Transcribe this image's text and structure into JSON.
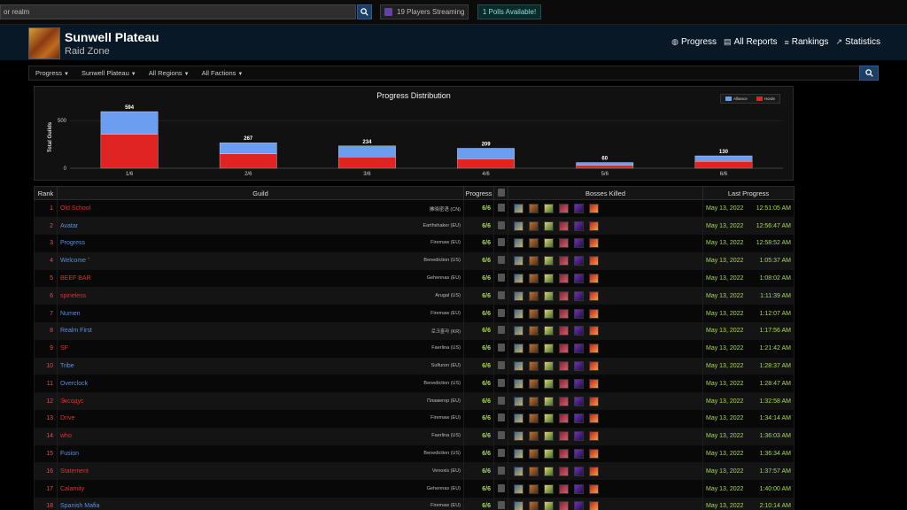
{
  "topbar": {
    "search_text": "or realm",
    "streaming_label": "19 Players Streaming",
    "polls_label": "1 Polls Available!"
  },
  "header": {
    "title": "Sunwell Plateau",
    "subtitle": "Raid Zone",
    "nav": [
      {
        "label": "Progress",
        "icon": "globe-icon"
      },
      {
        "label": "All Reports",
        "icon": "list-icon"
      },
      {
        "label": "Rankings",
        "icon": "bars-icon"
      },
      {
        "label": "Statistics",
        "icon": "trend-icon"
      }
    ]
  },
  "filters": [
    {
      "label": "Progress"
    },
    {
      "label": "Sunwell Plateau"
    },
    {
      "label": "All Regions"
    },
    {
      "label": "All Factions"
    }
  ],
  "colors": {
    "alliance": "#6b9ef0",
    "horde": "#e02424",
    "progress_green": "#a8d858"
  },
  "chart_data": {
    "type": "bar",
    "title": "Progress Distribution",
    "ylabel": "Total Guilds",
    "categories": [
      "1/6",
      "2/6",
      "3/6",
      "4/6",
      "5/6",
      "6/6"
    ],
    "totals": [
      594,
      267,
      234,
      209,
      60,
      130
    ],
    "series": [
      {
        "name": "Horde",
        "values": [
          355,
          150,
          118,
          98,
          32,
          72
        ]
      },
      {
        "name": "Alliance",
        "values": [
          239,
          117,
          116,
          111,
          28,
          58
        ]
      }
    ],
    "yticks": [
      0,
      500
    ],
    "ylim": [
      0,
      650
    ],
    "stacked": true,
    "legend": "top-right"
  },
  "table": {
    "headers": {
      "rank": "Rank",
      "guild": "Guild",
      "progress": "Progress",
      "bosses": "Bosses Killed",
      "last": "Last Progress"
    },
    "boss_icons": [
      "kalecgos-icon",
      "brutallus-icon",
      "felmyst-icon",
      "eredar-twins-icon",
      "muru-icon",
      "kiljaeden-icon"
    ],
    "rows": [
      {
        "rank": "1",
        "guild": "Old School",
        "faction": "horde",
        "realm": "拂晓密语 (CN)",
        "progress": "6/6",
        "date": "May 13, 2022",
        "time": "12:51:05 AM"
      },
      {
        "rank": "2",
        "guild": "Avatar",
        "faction": "alliance",
        "realm": "Earthshaker (EU)",
        "progress": "6/6",
        "date": "May 13, 2022",
        "time": "12:56:47 AM"
      },
      {
        "rank": "3",
        "guild": "Progress",
        "faction": "alliance",
        "realm": "Firemaw (EU)",
        "progress": "6/6",
        "date": "May 13, 2022",
        "time": "12:58:52 AM"
      },
      {
        "rank": "4",
        "guild": "Welcome",
        "faction": "alliance",
        "star": true,
        "realm": "Benediction (US)",
        "progress": "6/6",
        "date": "May 13, 2022",
        "time": "1:05:37 AM"
      },
      {
        "rank": "5",
        "guild": "BEEF BAR",
        "faction": "horde",
        "realm": "Gehennas (EU)",
        "progress": "6/6",
        "date": "May 13, 2022",
        "time": "1:08:02 AM"
      },
      {
        "rank": "6",
        "guild": "spineless",
        "faction": "horde",
        "realm": "Arugal (US)",
        "progress": "6/6",
        "date": "May 13, 2022",
        "time": "1:11:39 AM"
      },
      {
        "rank": "7",
        "guild": "Numen",
        "faction": "alliance",
        "realm": "Firemaw (EU)",
        "progress": "6/6",
        "date": "May 13, 2022",
        "time": "1:12:07 AM"
      },
      {
        "rank": "8",
        "guild": "Realm First",
        "faction": "alliance",
        "realm": "로크홀라 (KR)",
        "progress": "6/6",
        "date": "May 13, 2022",
        "time": "1:17:56 AM"
      },
      {
        "rank": "9",
        "guild": "SF",
        "faction": "horde",
        "realm": "Faerlina (US)",
        "progress": "6/6",
        "date": "May 13, 2022",
        "time": "1:21:42 AM"
      },
      {
        "rank": "10",
        "guild": "Tribe",
        "faction": "alliance",
        "realm": "Sulfuron (EU)",
        "progress": "6/6",
        "date": "May 13, 2022",
        "time": "1:28:37 AM"
      },
      {
        "rank": "11",
        "guild": "Overclock",
        "faction": "alliance",
        "realm": "Benediction (US)",
        "progress": "6/6",
        "date": "May 13, 2022",
        "time": "1:28:47 AM"
      },
      {
        "rank": "12",
        "guild": "Эксодус",
        "faction": "horde",
        "realm": "Пламегор (EU)",
        "progress": "6/6",
        "date": "May 13, 2022",
        "time": "1:32:58 AM"
      },
      {
        "rank": "13",
        "guild": "Drive",
        "faction": "horde",
        "realm": "Firemaw (EU)",
        "progress": "6/6",
        "date": "May 13, 2022",
        "time": "1:34:14 AM"
      },
      {
        "rank": "14",
        "guild": "who",
        "faction": "horde",
        "realm": "Faerlina (US)",
        "progress": "6/6",
        "date": "May 13, 2022",
        "time": "1:36:03 AM"
      },
      {
        "rank": "15",
        "guild": "Fusion",
        "faction": "alliance",
        "realm": "Benediction (US)",
        "progress": "6/6",
        "date": "May 13, 2022",
        "time": "1:36:34 AM"
      },
      {
        "rank": "16",
        "guild": "Statement",
        "faction": "horde",
        "realm": "Venoxis (EU)",
        "progress": "6/6",
        "date": "May 13, 2022",
        "time": "1:37:57 AM"
      },
      {
        "rank": "17",
        "guild": "Calamity",
        "faction": "horde",
        "realm": "Gehennas (EU)",
        "progress": "6/6",
        "date": "May 13, 2022",
        "time": "1:40:00 AM"
      },
      {
        "rank": "18",
        "guild": "Spanish Mafia",
        "faction": "alliance",
        "realm": "Firemaw (EU)",
        "progress": "6/6",
        "date": "May 13, 2022",
        "time": "2:10:14 AM"
      }
    ]
  }
}
